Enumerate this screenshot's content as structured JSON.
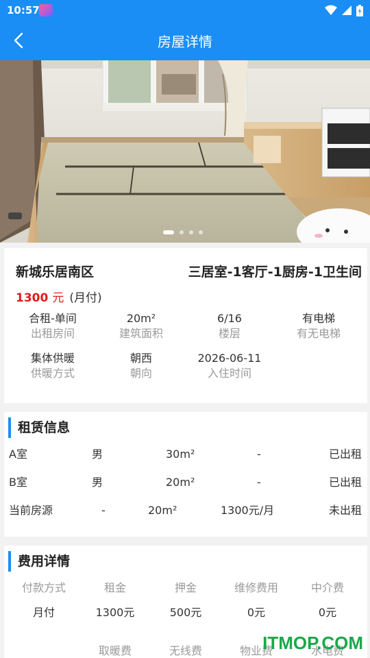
{
  "status_bar": {
    "time": "10:57"
  },
  "header": {
    "title": "房屋详情"
  },
  "carousel": {
    "image_count": 4,
    "active_index": 0
  },
  "summary": {
    "estate_name": "新城乐居南区",
    "layout": "三居室-1客厅-1厨房-1卫生间",
    "price": "1300",
    "price_unit": "元",
    "pay_type": "(月付)",
    "attributes": [
      {
        "value": "合租-单间",
        "label": "出租房间"
      },
      {
        "value": "20m²",
        "label": "建筑面积"
      },
      {
        "value": "6/16",
        "label": "楼层"
      },
      {
        "value": "有电梯",
        "label": "有无电梯"
      },
      {
        "value": "集体供暖",
        "label": "供暖方式"
      },
      {
        "value": "朝西",
        "label": "朝向"
      },
      {
        "value": "2026-06-11",
        "label": "入住时间"
      }
    ]
  },
  "rental": {
    "title": "租赁信息",
    "rows": [
      {
        "room": "A室",
        "gender": "男",
        "area": "30m²",
        "price": "-",
        "status": "已出租"
      },
      {
        "room": "B室",
        "gender": "男",
        "area": "20m²",
        "price": "-",
        "status": "已出租"
      },
      {
        "room": "当前房源",
        "gender": "-",
        "area": "20m²",
        "price": "1300元/月",
        "status": "未出租"
      }
    ]
  },
  "fees": {
    "title": "费用详情",
    "headers": [
      "付款方式",
      "租金",
      "押金",
      "维修费用",
      "中介费"
    ],
    "values": [
      "月付",
      "1300元",
      "500元",
      "0元",
      "0元"
    ],
    "headers2": [
      "取暖费",
      "无线费",
      "物业费",
      "水电费"
    ]
  },
  "watermark": "ITMOP.COM"
}
